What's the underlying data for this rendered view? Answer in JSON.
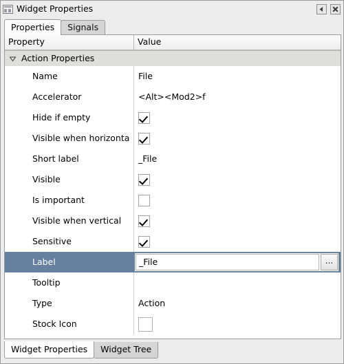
{
  "window": {
    "title": "Widget Properties",
    "icon": "window-panel-icon",
    "buttons": [
      {
        "name": "dock-button",
        "icon": "left-triangle-icon"
      },
      {
        "name": "close-button",
        "icon": "close-x-icon"
      }
    ]
  },
  "top_tabs": [
    {
      "label": "Properties",
      "active": true
    },
    {
      "label": "Signals",
      "active": false
    }
  ],
  "columns": {
    "property": "Property",
    "value": "Value"
  },
  "group": {
    "label": "Action Properties",
    "expanded": true,
    "expander_icon": "triangle-down-icon"
  },
  "rows": [
    {
      "property": "Name",
      "type": "text",
      "value": "File"
    },
    {
      "property": "Accelerator",
      "type": "text",
      "value": "<Alt><Mod2>f"
    },
    {
      "property": "Hide if empty",
      "type": "checkbox",
      "checked": true
    },
    {
      "property": "Visible when horizonta",
      "type": "checkbox",
      "checked": true
    },
    {
      "property": "Short label",
      "type": "text",
      "value": "_File"
    },
    {
      "property": "Visible",
      "type": "checkbox",
      "checked": true
    },
    {
      "property": "Is important",
      "type": "checkbox",
      "checked": false
    },
    {
      "property": "Visible when vertical",
      "type": "checkbox",
      "checked": true
    },
    {
      "property": "Sensitive",
      "type": "checkbox",
      "checked": true
    },
    {
      "property": "Label",
      "type": "editor",
      "value": "_File",
      "selected": true,
      "button_label": "..."
    },
    {
      "property": "Tooltip",
      "type": "text",
      "value": ""
    },
    {
      "property": "Type",
      "type": "text",
      "value": "Action"
    },
    {
      "property": "Stock Icon",
      "type": "iconbox",
      "value": ""
    }
  ],
  "bottom_tabs": [
    {
      "label": "Widget Properties",
      "active": true
    },
    {
      "label": "Widget Tree",
      "active": false
    }
  ],
  "colors": {
    "selection": "#65819f",
    "group_header": "#dededa",
    "window_bg": "#ececec",
    "tab_inactive": "#d5d5d5"
  }
}
